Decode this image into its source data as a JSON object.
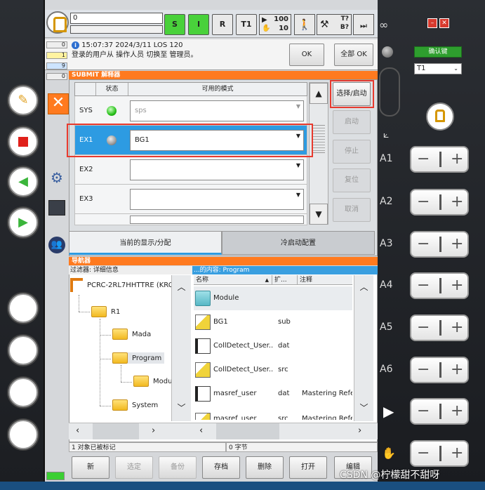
{
  "topbar": {
    "program_name": "0",
    "status_buttons": [
      "S",
      "I",
      "R",
      "T1"
    ],
    "speed_top": "100",
    "speed_bottom": "10",
    "question_top": "T?",
    "question_bottom": "B?",
    "infinity": "∞"
  },
  "messages": {
    "counts": [
      "0",
      "1",
      "9",
      "0"
    ],
    "time": "15:07:37 2024/3/11 LOS 120",
    "text": "登录的用户从 操作人员 切换至 管理员。",
    "ok_label": "OK",
    "all_ok_label": "全部 OK"
  },
  "submit": {
    "title": "SUBMIT 解释器",
    "col_state": "状态",
    "col_modules": "可用的模式",
    "rows": [
      {
        "name": "SYS",
        "value": "sps",
        "led": "green"
      },
      {
        "name": "EX1",
        "value": "BG1",
        "led": "gray"
      },
      {
        "name": "EX2",
        "value": "",
        "led": "none"
      },
      {
        "name": "EX3",
        "value": "",
        "led": "none"
      }
    ],
    "actions": [
      "选择/启动",
      "启动",
      "停止",
      "复位",
      "取消"
    ],
    "tab_current": "当前的显示/分配",
    "tab_cold": "冷启动配置"
  },
  "navigator": {
    "title": "导航器",
    "filter": "过滤器: 详细信息",
    "content_of": "...的内容: Program",
    "tree": [
      {
        "label": "PCRC-2RL7HHTTRE (KRC"
      },
      {
        "label": "R1"
      },
      {
        "label": "Mada"
      },
      {
        "label": "Program"
      },
      {
        "label": "Modu"
      },
      {
        "label": "System"
      }
    ],
    "columns": [
      "名称",
      "扩...",
      "注释"
    ],
    "files": [
      {
        "name": "Module",
        "ext": "",
        "comment": "",
        "icon": "folder"
      },
      {
        "name": "BG1",
        "ext": "sub",
        "comment": "",
        "icon": "src"
      },
      {
        "name": "CollDetect_User...",
        "ext": "dat",
        "comment": "",
        "icon": "dat"
      },
      {
        "name": "CollDetect_User...",
        "ext": "src",
        "comment": "",
        "icon": "src"
      },
      {
        "name": "masref_user",
        "ext": "dat",
        "comment": "Mastering Refer",
        "icon": "dat"
      },
      {
        "name": "masref_user",
        "ext": "src",
        "comment": "Mastering Refer",
        "icon": "src"
      }
    ],
    "status_left": "1 对象已被标记",
    "status_right": "0 字节"
  },
  "bottom_buttons": [
    "新",
    "选定",
    "备份",
    "存档",
    "删除",
    "打开",
    "编辑"
  ],
  "right_panel": {
    "confirm_label": "确认键",
    "mode": "T1",
    "axes": [
      "A1",
      "A2",
      "A3",
      "A4",
      "A5",
      "A6"
    ]
  },
  "watermark": "CSDN @柠檬甜不甜呀",
  "colors": {
    "accent_orange": "#ff7a1f",
    "selected_blue": "#2d9be2",
    "status_green": "#49d13b",
    "highlight_red": "#e83a2e"
  }
}
